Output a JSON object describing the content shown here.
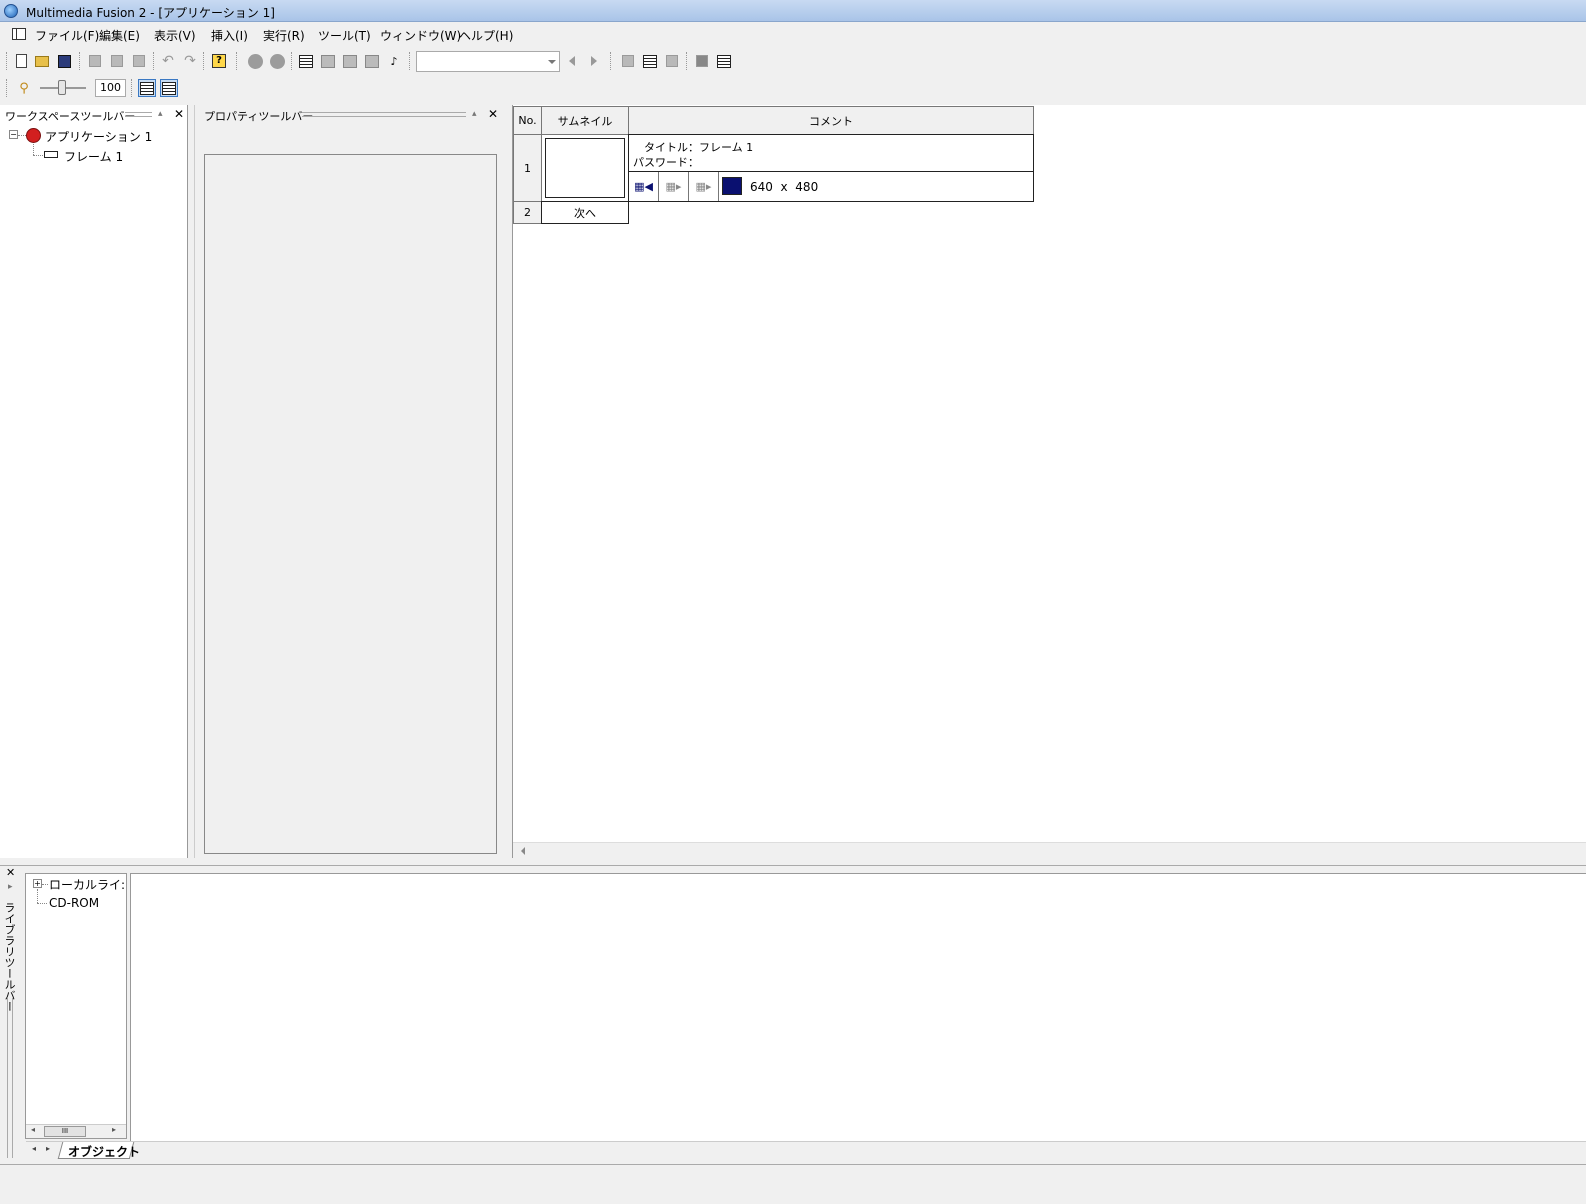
{
  "window": {
    "title": "Multimedia Fusion 2 - [アプリケーション 1]"
  },
  "menu": {
    "items": [
      "ファイル(F)",
      "編集(E)",
      "表示(V)",
      "挿入(I)",
      "実行(R)",
      "ツール(T)",
      "ウィンドウ(W)",
      "ヘルプ(H)"
    ]
  },
  "toolbar": {
    "zoom_value": "100",
    "frame_combo_value": ""
  },
  "workspace": {
    "title": "ワークスペースツールバー",
    "tree": {
      "application": "アプリケーション 1",
      "frame": "フレーム 1"
    }
  },
  "properties": {
    "title": "プロパティツールバー"
  },
  "storyboard": {
    "headers": {
      "no": "No.",
      "thumbnail": "サムネイル",
      "comment": "コメント"
    },
    "rows": [
      {
        "no": "1",
        "title_label": "タイトル：",
        "title_value": "フレーム 1",
        "password_label": "パスワード：",
        "width": "640",
        "times": "x",
        "height": "480"
      },
      {
        "no": "2",
        "next_label": "次へ"
      }
    ]
  },
  "library": {
    "title": "ライブラリツールバー",
    "tree": [
      "ローカルライ:",
      "CD-ROM"
    ],
    "tab": "オブジェクト"
  },
  "colors": {
    "frame_bg": "#0a1070",
    "app_icon": "#d21f1f"
  }
}
